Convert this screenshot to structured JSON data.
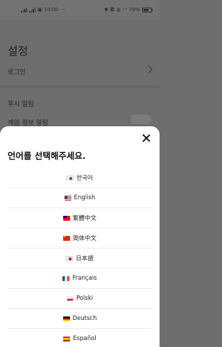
{
  "status_bar": {
    "time": "10:00",
    "dots": "···",
    "battery": "79%",
    "battery_level": 0.79
  },
  "settings": {
    "title": "설정",
    "rows": {
      "login": "로그인",
      "push": "푸시 알림",
      "game_info": "게임 정보 알림"
    }
  },
  "sheet": {
    "title": "언어를 선택해주세요.",
    "languages": [
      {
        "label": "한국어",
        "flag": "kr-flag-icon"
      },
      {
        "label": "English",
        "flag": "us-flag-icon"
      },
      {
        "label": "繁體中文",
        "flag": "tw-flag-icon"
      },
      {
        "label": "简体中文",
        "flag": "cn-flag-icon"
      },
      {
        "label": "日本語",
        "flag": "jp-flag-icon"
      },
      {
        "label": "Français",
        "flag": "fr-flag-icon"
      },
      {
        "label": "Polski",
        "flag": "pl-flag-icon"
      },
      {
        "label": "Deutsch",
        "flag": "de-flag-icon"
      },
      {
        "label": "Español",
        "flag": "es-flag-icon"
      }
    ]
  }
}
